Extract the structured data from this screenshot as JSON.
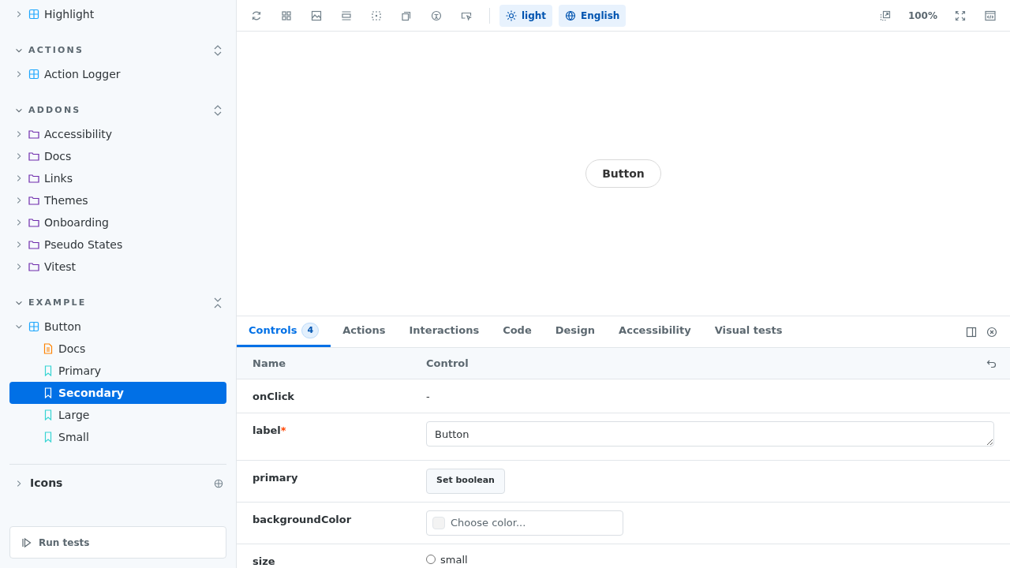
{
  "sidebar": {
    "top_items": [
      {
        "label": "Highlight",
        "kind": "component",
        "expanded": false,
        "selected": false
      }
    ],
    "sections": [
      {
        "title": "ACTIONS",
        "all_expanded": false,
        "items": [
          {
            "label": "Action Logger",
            "kind": "component",
            "expanded": false,
            "selected": false
          }
        ]
      },
      {
        "title": "ADDONS",
        "all_expanded": false,
        "items": [
          {
            "label": "Accessibility",
            "kind": "folder",
            "expanded": false,
            "selected": false
          },
          {
            "label": "Docs",
            "kind": "folder",
            "expanded": false,
            "selected": false
          },
          {
            "label": "Links",
            "kind": "folder",
            "expanded": false,
            "selected": false
          },
          {
            "label": "Themes",
            "kind": "folder",
            "expanded": false,
            "selected": false
          },
          {
            "label": "Onboarding",
            "kind": "folder",
            "expanded": false,
            "selected": false
          },
          {
            "label": "Pseudo States",
            "kind": "folder",
            "expanded": false,
            "selected": false
          },
          {
            "label": "Vitest",
            "kind": "folder",
            "expanded": false,
            "selected": false
          }
        ]
      },
      {
        "title": "EXAMPLE",
        "all_expanded": true,
        "items": [
          {
            "label": "Button",
            "kind": "component",
            "expanded": true,
            "selected": false,
            "children": [
              {
                "label": "Docs",
                "kind": "docs",
                "selected": false
              },
              {
                "label": "Primary",
                "kind": "story",
                "selected": false
              },
              {
                "label": "Secondary",
                "kind": "story",
                "selected": true
              },
              {
                "label": "Large",
                "kind": "story",
                "selected": false
              },
              {
                "label": "Small",
                "kind": "story",
                "selected": false
              }
            ]
          }
        ]
      }
    ],
    "icons_section": {
      "label": "Icons",
      "expanded": false
    },
    "run_tests": "Run tests"
  },
  "toolbar": {
    "theme": "light",
    "locale": "English",
    "zoom": "100%"
  },
  "preview": {
    "button": "Button"
  },
  "panel": {
    "tabs": [
      {
        "label": "Controls",
        "badge": "4",
        "selected": true
      },
      {
        "label": "Actions",
        "selected": false
      },
      {
        "label": "Interactions",
        "selected": false
      },
      {
        "label": "Code",
        "selected": false
      },
      {
        "label": "Design",
        "selected": false
      },
      {
        "label": "Accessibility",
        "selected": false
      },
      {
        "label": "Visual tests",
        "selected": false
      }
    ],
    "columns": [
      "Name",
      "Control"
    ],
    "rows": [
      {
        "name": "onClick",
        "control": {
          "kind": "text",
          "value": "-"
        }
      },
      {
        "name": "label",
        "required_mark": "*",
        "control": {
          "kind": "textarea",
          "value": "Button"
        }
      },
      {
        "name": "primary",
        "control": {
          "kind": "button",
          "value": "Set boolean"
        }
      },
      {
        "name": "backgroundColor",
        "control": {
          "kind": "color",
          "placeholder": "Choose color..."
        }
      },
      {
        "name": "size",
        "control": {
          "kind": "radio",
          "options": [
            {
              "label": "small",
              "checked": false
            }
          ]
        }
      }
    ]
  }
}
